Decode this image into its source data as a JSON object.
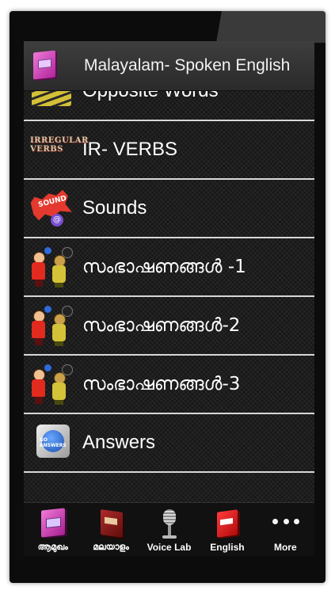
{
  "actionbar": {
    "title": "Malayalam- Spoken English",
    "icon": "book-icon"
  },
  "list": {
    "items": [
      {
        "label": "Opposite Words",
        "icon": "opposite-words-icon"
      },
      {
        "label": "IR- VERBS",
        "icon": "irregular-verbs-icon",
        "thumb_lines": [
          "IRREGULAR",
          "VERBS"
        ]
      },
      {
        "label": "Sounds",
        "icon": "sound-icon",
        "thumb_text": "SOUND",
        "thumb_symbol": "@"
      },
      {
        "label": "സംഭാഷണങ്ങൾ -1",
        "icon": "people-talking-icon"
      },
      {
        "label": "സംഭാഷണങ്ങൾ-2",
        "icon": "people-talking-icon"
      },
      {
        "label": "സംഭാഷണങ്ങൾ-3",
        "icon": "people-talking-icon"
      },
      {
        "label": "Answers",
        "icon": "answers-button-icon",
        "thumb_text": "GO ANSWERS"
      }
    ]
  },
  "tabbar": {
    "tabs": [
      {
        "label": "ആമുഖം",
        "icon": "pink-book-icon"
      },
      {
        "label": "മലയാളം",
        "icon": "dark-red-book-icon"
      },
      {
        "label": "Voice Lab",
        "icon": "microphone-icon"
      },
      {
        "label": "English",
        "icon": "red-book-icon"
      },
      {
        "label": "More",
        "icon": "more-dots-icon"
      }
    ]
  },
  "colors": {
    "actionbar": "#2e2e2e",
    "divider": "#d8d8d8",
    "text": "#ffffff"
  }
}
